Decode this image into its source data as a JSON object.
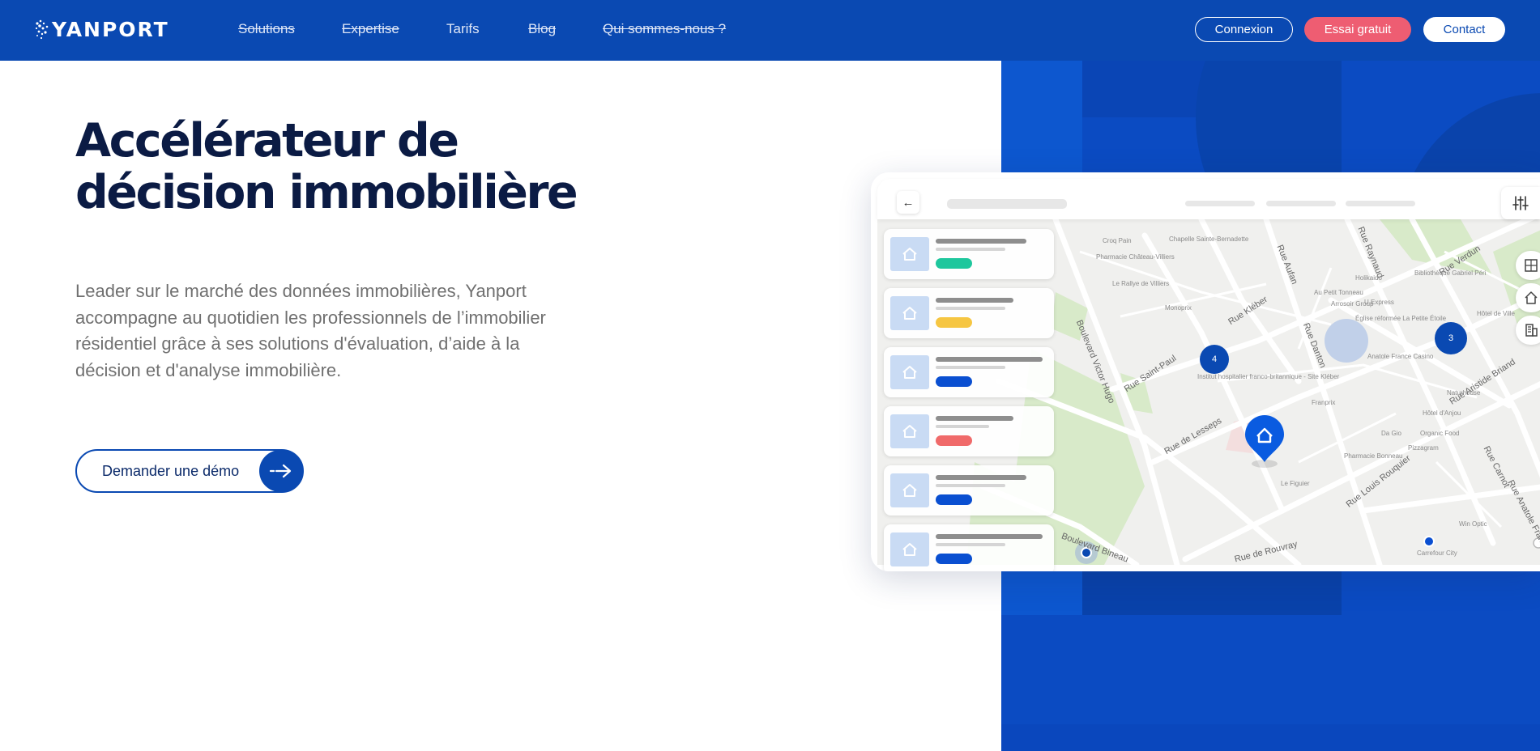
{
  "nav": {
    "logo": "YANPORT",
    "links": [
      {
        "label": "Solutions"
      },
      {
        "label": "Expertise"
      },
      {
        "label": "Tarifs"
      },
      {
        "label": "Blog"
      },
      {
        "label": "Qui sommes-nous ?"
      }
    ],
    "connexion": "Connexion",
    "essai": "Essai gratuit",
    "contact": "Contact"
  },
  "hero": {
    "title_line1": "Accélérateur de",
    "title_line2": "décision immobilière",
    "text": "Leader sur le marché des données immobilières, Yanport accompagne au quotidien les professionnels de l’immobilier résidentiel grâce à ses solutions d'évaluation, d’aide à la décision et d'analyse immobilière.",
    "cta": "Demander une démo"
  },
  "map": {
    "clusters": [
      "4",
      "3"
    ],
    "roads": [
      "Boulevard Victor Hugo",
      "Rue Saint-Paul",
      "Rue de Lesseps",
      "Boulevard Bineau",
      "Rue de Rouvray",
      "Rue Kléber",
      "Rue Danton",
      "Rue Aristide Briand",
      "Rue Louis Rouquier",
      "Rue Carnot",
      "Rue Anatole France",
      "Rue Verdun",
      "Rue Aufan",
      "Rue Raynaud"
    ],
    "places": [
      "Croq Pain",
      "Pharmacie Château-Villiers",
      "Le Rallye de Villiers",
      "Monoprix",
      "Chapelle Sainte-Bernadette",
      "Institut hospitalier franco-britannique - Site Kléber",
      "Franprix",
      "Au Petit Tonneau",
      "U Express",
      "Église réformée La Petite Étoile",
      "Anatole France Casino",
      "Bibliothèque Gabriel Péri",
      "Hôtel de Ville",
      "Pharmacie Bonneau",
      "Organic Food",
      "Pizzagram",
      "Le Figuier",
      "Carrefour City",
      "Win Optic",
      "Naturhouse",
      "Hôtel d'Anjou",
      "Da Gio",
      "Arrosoir Group",
      "Holikaido"
    ],
    "tag_colors": [
      "#1ec79d",
      "#f6c642",
      "#0a4fd1",
      "#f06a6a",
      "#0a4fd1",
      "#0a4fd1"
    ]
  }
}
